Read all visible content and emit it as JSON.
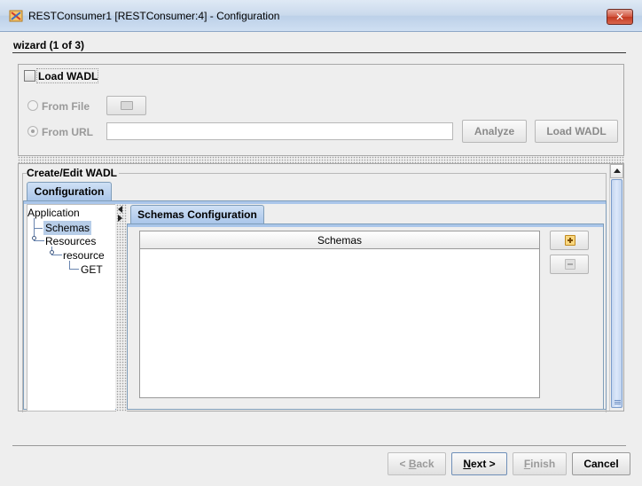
{
  "window": {
    "title": "RESTConsumer1 [RESTConsumer:4] - Configuration",
    "close_glyph": "✕"
  },
  "wizard": {
    "step_title": "wizard (1 of 3)"
  },
  "load_wadl": {
    "checkbox_label": "Load WADL",
    "checked": false,
    "from_file_label": "From File",
    "from_url_label": "From URL",
    "url_value": "",
    "analyze_label": "Analyze",
    "load_button_label": "Load WADL"
  },
  "edit_wadl": {
    "title": "Create/Edit WADL",
    "tab_label": "Configuration",
    "tree": {
      "application": "Application",
      "schemas": "Schemas",
      "resources": "Resources",
      "resource": "resource",
      "get": "GET"
    },
    "schemas_tab_label": "Schemas Configuration",
    "schemas_column_header": "Schemas",
    "schemas_rows": []
  },
  "footer": {
    "back_prefix": "< ",
    "back_key": "B",
    "back_rest": "ack",
    "next_key": "N",
    "next_rest": "ext >",
    "finish_key": "F",
    "finish_rest": "inish",
    "cancel_label": "Cancel"
  }
}
